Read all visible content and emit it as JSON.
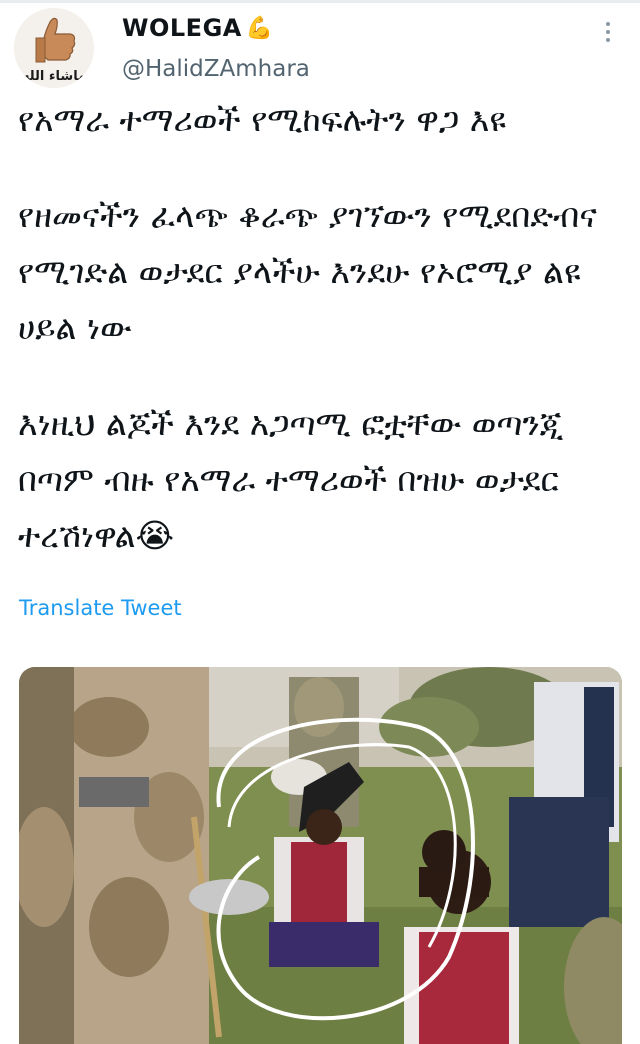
{
  "tweet": {
    "display_name": "WOLEGA",
    "name_emoji": "💪",
    "handle": "@HalidZAmhara",
    "paragraphs": [
      "የአማራ ተማሪወች የሚከፍሉትን ዋጋ እዩ",
      "የዘመናችን ፈላጭ ቆራጭ ያገኘውን የሚደበድብና የሚገድል ወታደር ያላችሁ እንደሁ የኦሮሚያ ልዩ ሀይል ነው",
      "እነዚህ ልጆች እንደ አጋጣሚ ፎቷቸው ወጣንጂ በጣም ብዙ የአማራ ተማሪወች በዝሁ ወታደር ተረሽነዋል"
    ],
    "end_emoji": "😭",
    "translate_label": "Translate Tweet"
  },
  "avatar": {
    "caption": "ماشاء الله"
  },
  "icons": {
    "more": "more-vertical-icon"
  },
  "colors": {
    "link": "#1d9bf0",
    "handle": "#536471",
    "text": "#0f1419"
  }
}
